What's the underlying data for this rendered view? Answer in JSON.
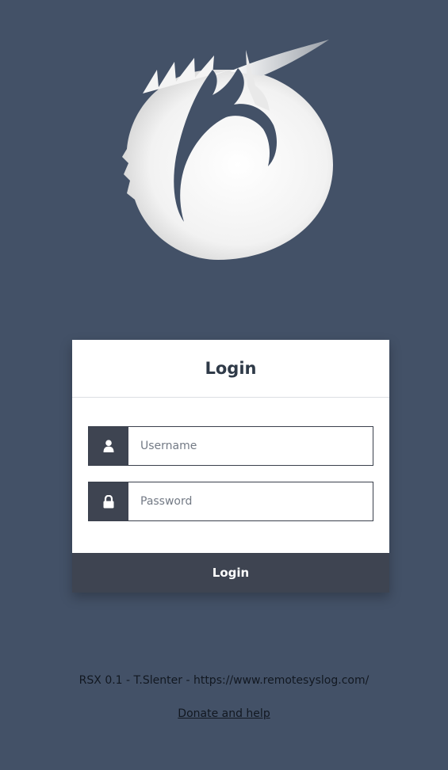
{
  "logo": {
    "icon": "fox-logo-icon"
  },
  "login_card": {
    "title": "Login",
    "username": {
      "placeholder": "Username",
      "value": "",
      "icon": "user-icon"
    },
    "password": {
      "placeholder": "Password",
      "value": "",
      "icon": "lock-icon"
    },
    "submit_label": "Login"
  },
  "footer": {
    "credit_text": "RSX 0.1 - T.Slenter - https://www.remotesyslog.com/",
    "donate_label": "Donate and help"
  },
  "colors": {
    "background": "#435167",
    "card": "#ffffff",
    "accent_dark": "#3e4451",
    "text_dark": "#2f3a48"
  }
}
